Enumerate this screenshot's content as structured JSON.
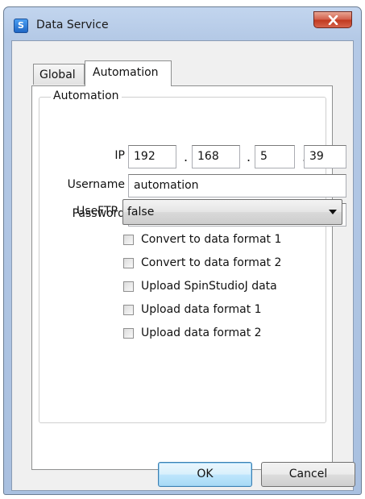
{
  "window": {
    "title": "Data Service",
    "icon": "app-s-icon"
  },
  "tabs": [
    {
      "label": "Global",
      "selected": false
    },
    {
      "label": "Automation",
      "selected": true
    }
  ],
  "group": {
    "title": "Automation"
  },
  "form": {
    "ip_label": "IP",
    "ip_octets": [
      "192",
      "168",
      "5",
      "39"
    ],
    "ip_separator": ".",
    "username_label": "Username",
    "username_value": "automation",
    "password_label": "Password",
    "password_masked_length": 3,
    "useftp_label": "UseFTP",
    "useftp_value": "false"
  },
  "checkboxes": [
    {
      "label": "Convert to data format 1",
      "checked": false
    },
    {
      "label": "Convert to data format 2",
      "checked": false
    },
    {
      "label": "Upload SpinStudioJ data",
      "checked": false
    },
    {
      "label": "Upload data format 1",
      "checked": false
    },
    {
      "label": "Upload data format 2",
      "checked": false
    }
  ],
  "buttons": {
    "ok": "OK",
    "cancel": "Cancel"
  },
  "colors": {
    "title_bar": "#b4c9e6",
    "close_button": "#c7462e",
    "ok_border": "#3c7fb1"
  }
}
